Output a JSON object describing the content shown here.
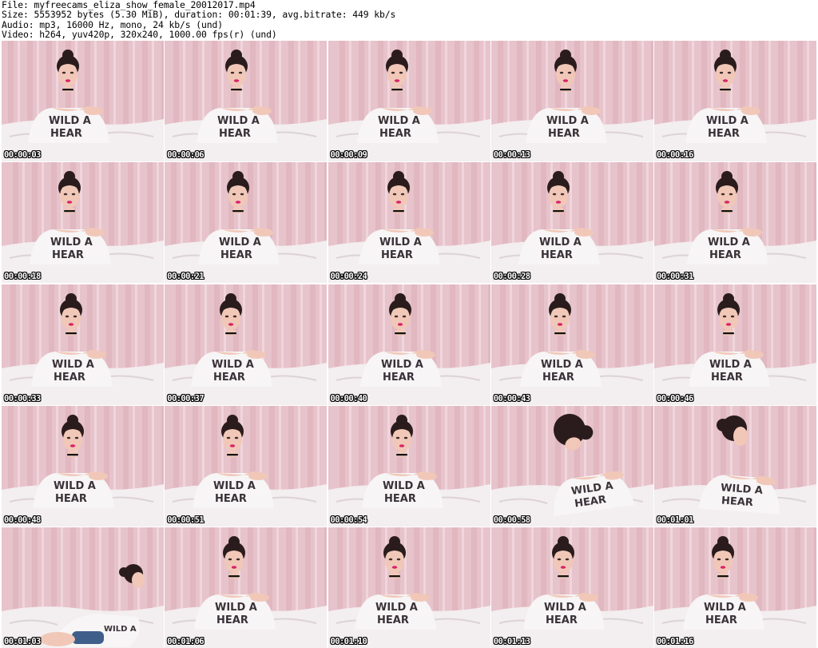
{
  "header": {
    "file_line": "File: myfreecams_eliza_show_female_20012017.mp4",
    "size_line": "Size: 5553952 bytes (5.30 MiB), duration: 00:01:39, avg.bitrate: 449 kb/s",
    "audio_line": "Audio: mp3, 16000 Hz, mono, 24 kb/s (und)",
    "video_line": "Video: h264, yuv420p, 320x240, 1000.00 fps(r) (und)"
  },
  "shirt_text": [
    "WILD A",
    "HEAR"
  ],
  "frames": [
    {
      "time": "00:00:03",
      "pose": "front"
    },
    {
      "time": "00:00:06",
      "pose": "front"
    },
    {
      "time": "00:00:09",
      "pose": "front"
    },
    {
      "time": "00:00:13",
      "pose": "front"
    },
    {
      "time": "00:00:16",
      "pose": "front"
    },
    {
      "time": "00:00:18",
      "pose": "front"
    },
    {
      "time": "00:00:21",
      "pose": "front"
    },
    {
      "time": "00:00:24",
      "pose": "front"
    },
    {
      "time": "00:00:28",
      "pose": "front"
    },
    {
      "time": "00:00:31",
      "pose": "front"
    },
    {
      "time": "00:00:33",
      "pose": "front"
    },
    {
      "time": "00:00:37",
      "pose": "front"
    },
    {
      "time": "00:00:40",
      "pose": "front"
    },
    {
      "time": "00:00:43",
      "pose": "front"
    },
    {
      "time": "00:00:46",
      "pose": "front"
    },
    {
      "time": "00:00:48",
      "pose": "front"
    },
    {
      "time": "00:00:51",
      "pose": "front"
    },
    {
      "time": "00:00:54",
      "pose": "front"
    },
    {
      "time": "00:00:58",
      "pose": "lean"
    },
    {
      "time": "00:01:01",
      "pose": "side"
    },
    {
      "time": "00:01:03",
      "pose": "lying"
    },
    {
      "time": "00:01:06",
      "pose": "front"
    },
    {
      "time": "00:01:10",
      "pose": "front"
    },
    {
      "time": "00:01:13",
      "pose": "front"
    },
    {
      "time": "00:01:16",
      "pose": "front"
    }
  ],
  "colors": {
    "curtain": "#e7c3cb",
    "curtain_fold": "#d9a9b4",
    "bed": "#f3eef0",
    "skin": "#f1c8b8",
    "hair": "#2a1c1c",
    "shirt": "#f7f5f6",
    "shirt_text": "#3a3238",
    "lips": "#d8246a",
    "timestamp": "#ffffff"
  }
}
